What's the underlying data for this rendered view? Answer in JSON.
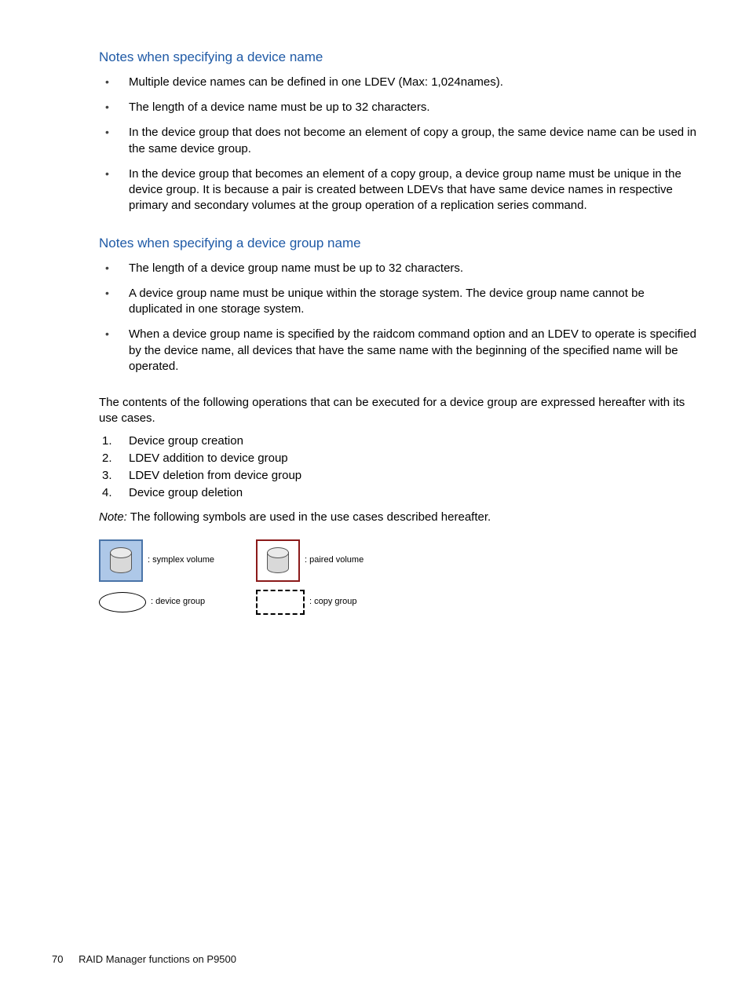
{
  "section1": {
    "heading": "Notes when specifying a device name",
    "bullets": [
      "Multiple device names can be defined in one LDEV (Max: 1,024names).",
      "The length of a device name must be up to 32 characters.",
      "In the device group that does not become an element of copy a group, the same device name can be used in the same device group.",
      "In the device group that becomes an element of a copy group, a device group name must be unique in the device group. It is because a pair is created between LDEVs that have same device names in respective primary and secondary volumes at the group operation of a replication series command."
    ]
  },
  "section2": {
    "heading": "Notes when specifying a device group name",
    "bullets": [
      "The length of a device group name must be up to 32 characters.",
      "A device group name must be unique within the storage system. The device group name cannot be duplicated in one storage system.",
      "When a device group name is specified by the raidcom command option and an LDEV to operate is specified by the device name, all devices that have the same name with the beginning of the specified name will be operated."
    ]
  },
  "intro": "The contents of the following operations that can be executed for a device group are expressed hereafter with its use cases.",
  "operations": [
    "Device group creation",
    "LDEV addition to device group",
    "LDEV deletion from device group",
    "Device group deletion"
  ],
  "note": {
    "label": "Note:",
    "text": "The following symbols are used in the use cases described hereafter."
  },
  "legend": {
    "simplex": ": symplex volume",
    "paired": ": paired volume",
    "devgroup": ": device group",
    "copygroup": ": copy group"
  },
  "footer": {
    "page": "70",
    "title": "RAID Manager functions on P9500"
  }
}
